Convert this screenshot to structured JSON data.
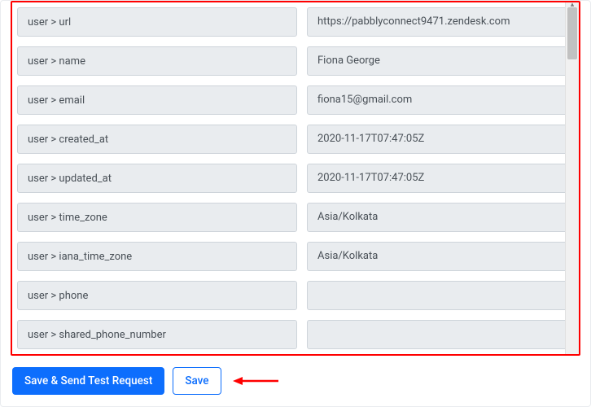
{
  "fields": [
    {
      "key": "user > url",
      "value": "https://pabblyconnect9471.zendesk.com"
    },
    {
      "key": "user > name",
      "value": "Fiona George"
    },
    {
      "key": "user > email",
      "value": "fiona15@gmail.com"
    },
    {
      "key": "user > created_at",
      "value": "2020-11-17T07:47:05Z"
    },
    {
      "key": "user > updated_at",
      "value": "2020-11-17T07:47:05Z"
    },
    {
      "key": "user > time_zone",
      "value": "Asia/Kolkata"
    },
    {
      "key": "user > iana_time_zone",
      "value": "Asia/Kolkata"
    },
    {
      "key": "user > phone",
      "value": ""
    },
    {
      "key": "user > shared_phone_number",
      "value": ""
    }
  ],
  "buttons": {
    "primary": "Save & Send Test Request",
    "secondary": "Save"
  }
}
